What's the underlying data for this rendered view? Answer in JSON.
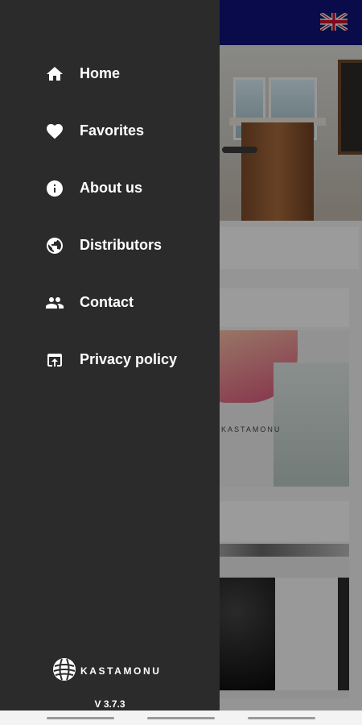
{
  "background_app": {
    "flag_icon": "uk-flag-icon",
    "brand_watermark": "KASTAMONU",
    "appbar_color": "#10127a"
  },
  "drawer": {
    "background_color": "#2b2b2b",
    "items": [
      {
        "label": "Home",
        "icon": "home-icon"
      },
      {
        "label": "Favorites",
        "icon": "heart-icon"
      },
      {
        "label": "About us",
        "icon": "info-icon"
      },
      {
        "label": "Distributors",
        "icon": "globe-icon"
      },
      {
        "label": "Contact",
        "icon": "people-icon"
      },
      {
        "label": "Privacy policy",
        "icon": "open-in-browser-icon"
      }
    ],
    "logo_text": "KASTAMONU",
    "version": "V 3.7.3"
  }
}
